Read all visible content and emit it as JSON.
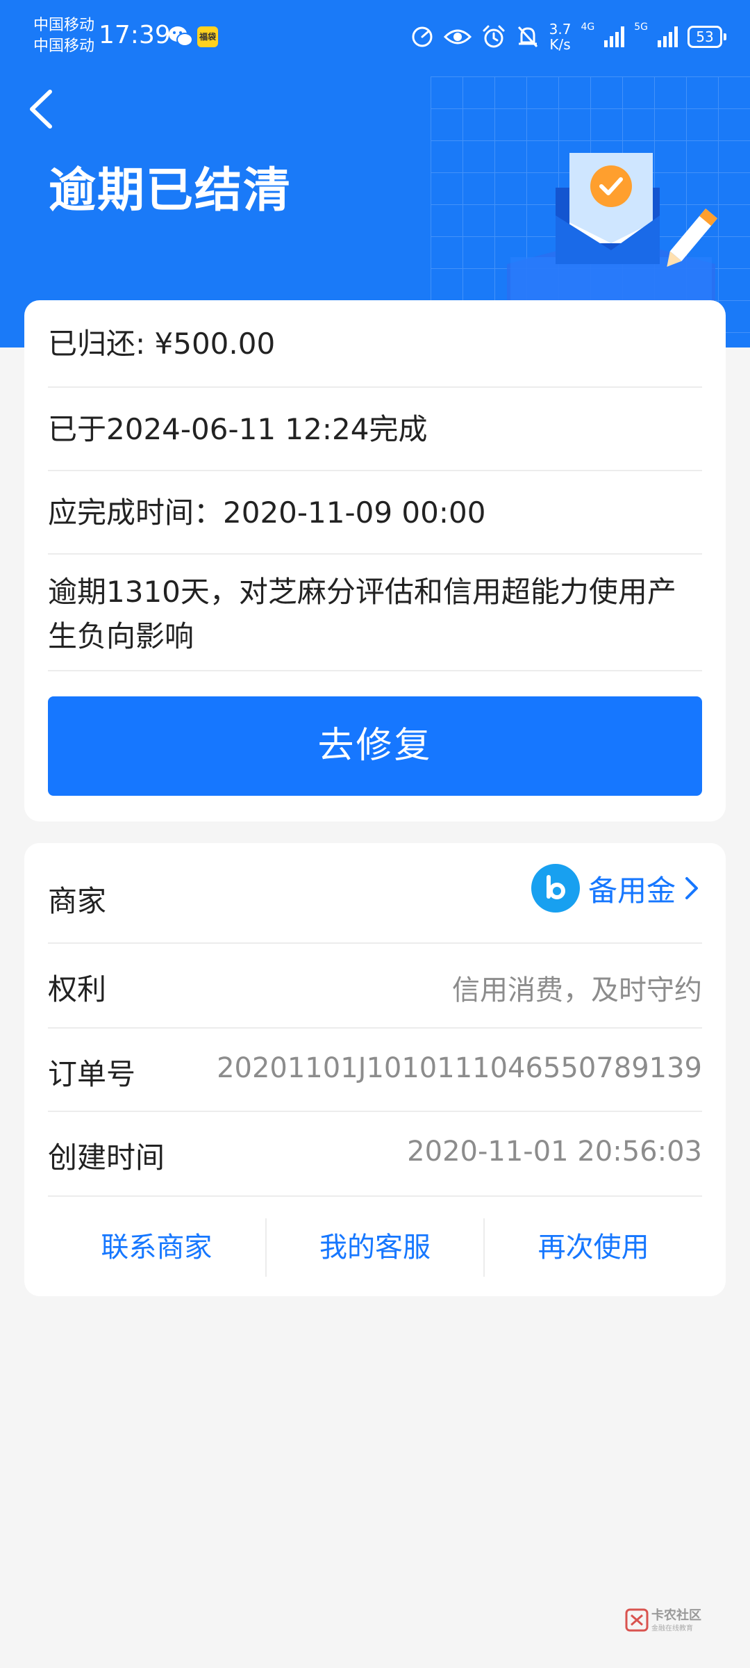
{
  "status_bar": {
    "carrier_1": "中国移动",
    "carrier_2": "中国移动",
    "time": "17:39",
    "app_badge": "福袋",
    "net_speed_value": "3.7",
    "net_speed_unit": "K/s",
    "sim1_label": "4G",
    "sim2_label": "5G",
    "battery": "53"
  },
  "header": {
    "title": "逾期已结清"
  },
  "repayment": {
    "returned": "已归还: ¥500.00",
    "completed_at": "已于2024-06-11 12:24完成",
    "due_time": "应完成时间：2020-11-09 00:00",
    "notice": "逾期1310天，对芝麻分评估和信用超能力使用产生负向影响",
    "fix_button": "去修复"
  },
  "order": {
    "merchant_label": "商家",
    "merchant_name": "备用金",
    "rights_label": "权利",
    "rights_value": "信用消费，及时守约",
    "order_no_label": "订单号",
    "order_no_value": "20201101J1010111046550789139",
    "created_label": "创建时间",
    "created_value": "2020-11-01 20:56:03"
  },
  "actions": {
    "contact_merchant": "联系商家",
    "my_service": "我的客服",
    "use_again": "再次使用"
  },
  "watermark": {
    "title": "卡农社区",
    "subtitle": "金融在线教育"
  },
  "colors": {
    "header_blue": "#1a7af8",
    "primary_blue": "#1677ff",
    "background": "#f5f5f5"
  }
}
